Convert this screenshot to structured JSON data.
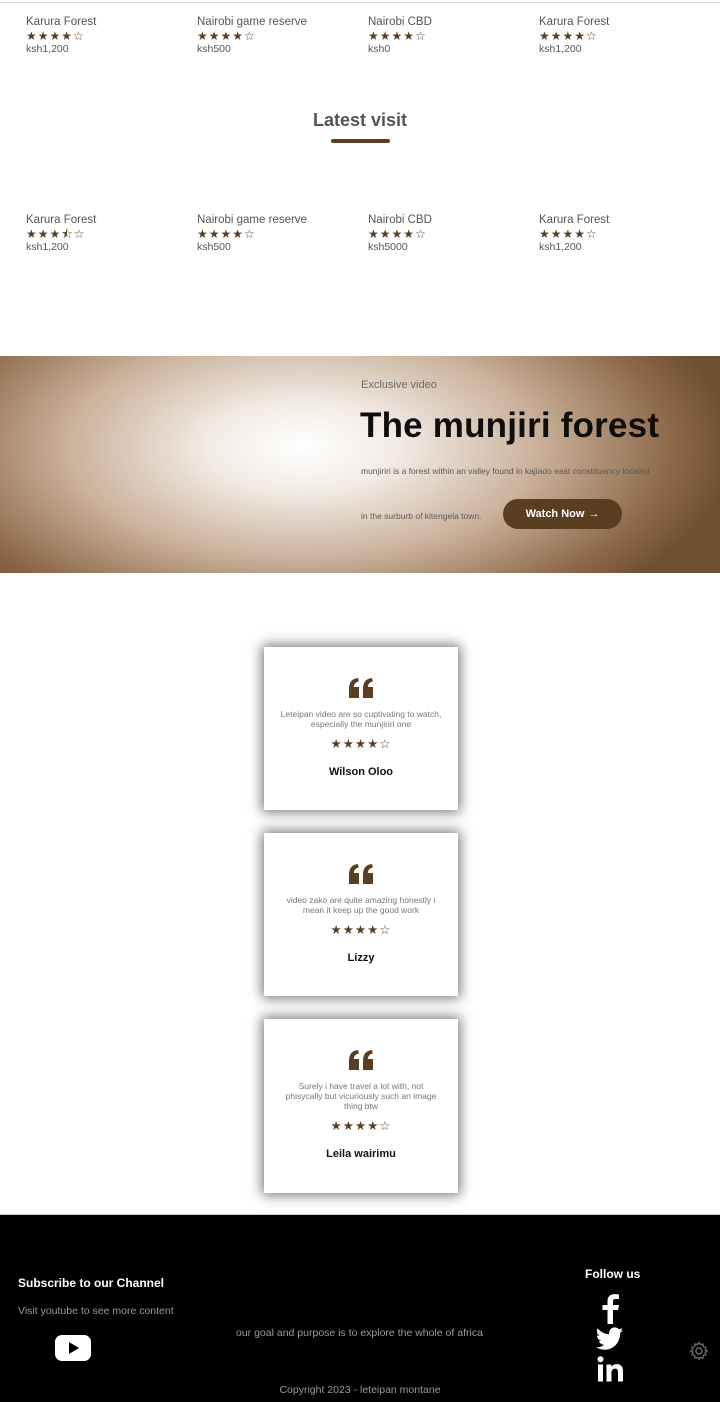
{
  "top_places": [
    {
      "name": "Karura Forest",
      "stars": "★★★★☆",
      "rating": 4,
      "price": "ksh1,200"
    },
    {
      "name": "Nairobi game reserve",
      "stars": "★★★★☆",
      "rating": 4,
      "price": "ksh500"
    },
    {
      "name": "Nairobi CBD",
      "stars": "★★★★☆",
      "rating": 4,
      "price": "ksh0"
    },
    {
      "name": "Karura Forest",
      "stars": "★★★★☆",
      "rating": 4,
      "price": "ksh1,200"
    }
  ],
  "latest_visit": {
    "title": "Latest visit",
    "places": [
      {
        "name": "Karura Forest",
        "stars": "★★★⯪☆",
        "rating": 3.5,
        "price": "ksh1,200"
      },
      {
        "name": "Nairobi game reserve",
        "stars": "★★★★☆",
        "rating": 4,
        "price": "ksh500"
      },
      {
        "name": "Nairobi CBD",
        "stars": "★★★★☆",
        "rating": 4,
        "price": "ksh5000"
      },
      {
        "name": "Karura Forest",
        "stars": "★★★★☆",
        "rating": 4,
        "price": "ksh1,200"
      }
    ]
  },
  "hero": {
    "kicker": "Exclusive video",
    "title": "The munjiri forest",
    "desc_line1": "munjiriri is a forest within an valley found in kajiado east constituency located",
    "desc_line2": "in the surburb of kitengela town.",
    "button_label": "Watch Now",
    "button_arrow": "→"
  },
  "testimonials": [
    {
      "text": "Leteipan video are so cuptivating to watch, especially the munjiriri one",
      "stars": "★★★★☆",
      "rating": 4,
      "name": "Wilson Oloo"
    },
    {
      "text": "video zako are quite amazing honestly i mean it keep up the good work",
      "stars": "★★★★☆",
      "rating": 4,
      "name": "Lizzy"
    },
    {
      "text": "Surely i have travel a lot with, not phisycally but vicuriously such an image thing btw",
      "stars": "★★★★☆",
      "rating": 4,
      "name": "Leila wairimu"
    }
  ],
  "footer": {
    "subscribe_title": "Subscribe to our Channel",
    "subscribe_text": "Visit youtube to see more content",
    "goal_text": "our goal and purpose is to explore the whole of africa",
    "follow_title": "Follow us",
    "copyright": "Copyright 2023 - leteipan montane"
  },
  "icons": {
    "quote": "quote-icon",
    "youtube": "youtube-icon",
    "facebook": "facebook-icon",
    "twitter": "twitter-icon",
    "linkedin": "linkedin-icon",
    "settings": "gear-icon"
  },
  "colors": {
    "accent": "#5a3e22",
    "footer_bg": "#000000"
  }
}
